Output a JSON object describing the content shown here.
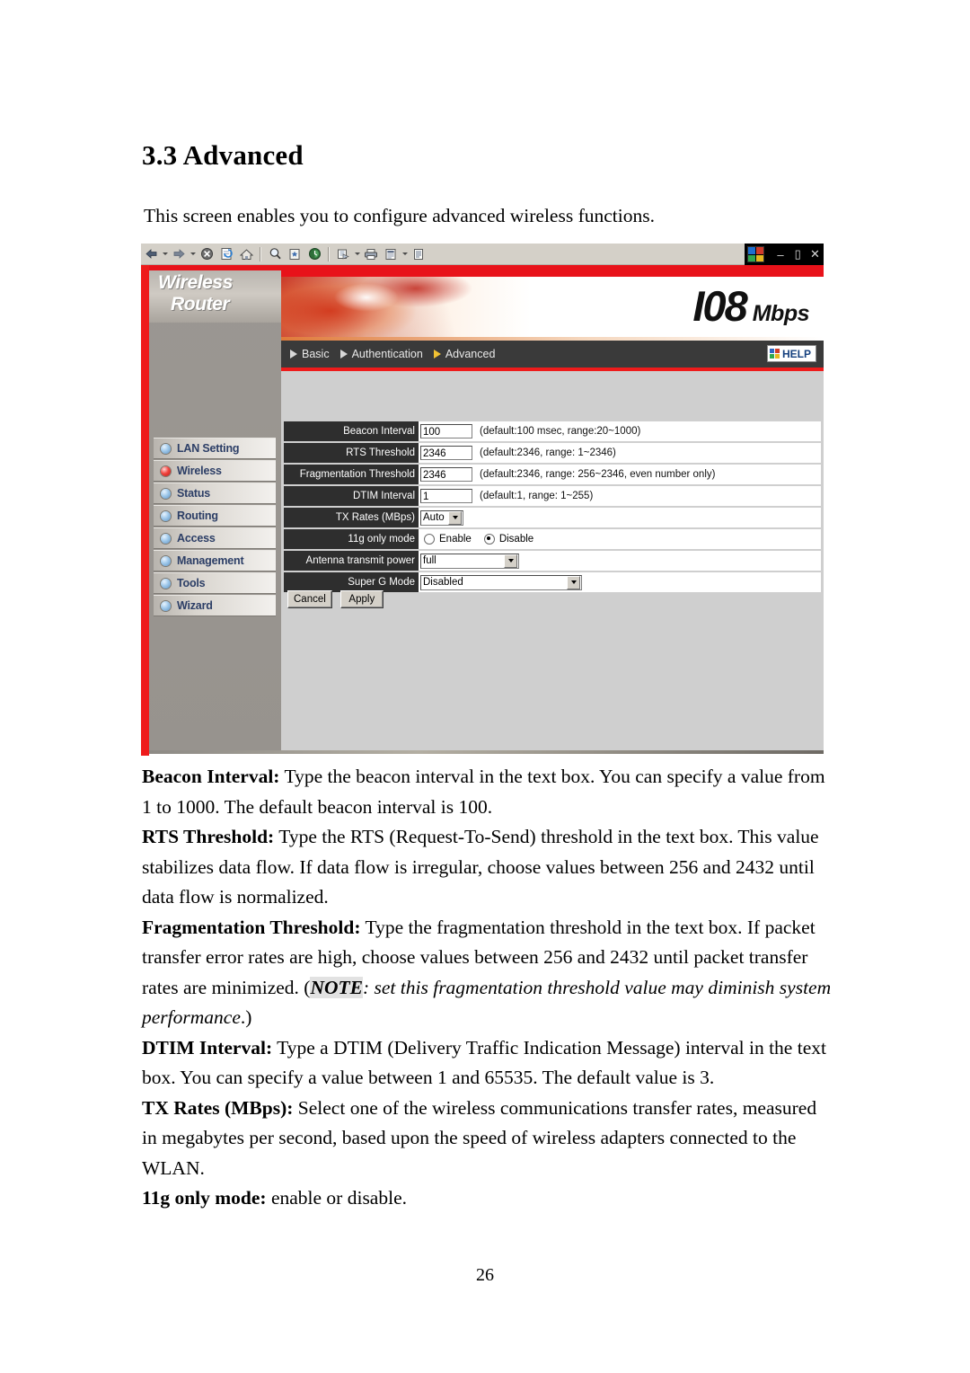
{
  "document": {
    "heading": "3.3 Advanced",
    "intro": "This screen enables you to configure advanced wireless functions.",
    "page_number": "26",
    "paragraphs": [
      {
        "term": "Beacon Interval:",
        "text": " Type the beacon interval in the text box. You can specify a value from 1 to 1000. The default beacon interval is 100."
      },
      {
        "term": "RTS Threshold:",
        "text": " Type the RTS (Request-To-Send) threshold in the text box. This value stabilizes data flow. If data flow is irregular, choose values between 256 and 2432 until data flow is normalized."
      },
      {
        "term": "Fragmentation Threshold:",
        "text": " Type the fragmentation threshold in the text box. If packet transfer error rates are high, choose values between 256 and 2432 until packet transfer rates are minimized. (",
        "note_tag": "NOTE",
        "note_text": ": set this fragmentation threshold value may diminish system performance",
        "note_tail": ".)"
      },
      {
        "term": "DTIM Interval:",
        "text": " Type a DTIM (Delivery Traffic Indication Message) interval in the text box. You can specify a value between 1 and 65535. The default value is 3."
      },
      {
        "term": "TX Rates (MBps):",
        "text": " Select one of the wireless communications transfer rates, measured in megabytes per second, based upon the speed of wireless adapters connected to the WLAN."
      },
      {
        "term": "11g only mode:",
        "text": " enable or disable."
      }
    ]
  },
  "browser": {
    "toolbar_icons": [
      "back-icon",
      "back-dropdown-icon",
      "forward-icon",
      "forward-dropdown-icon",
      "stop-icon",
      "refresh-icon",
      "home-icon",
      "search-icon",
      "favorites-icon",
      "history-icon",
      "mail-icon",
      "mail-dropdown-icon",
      "print-icon",
      "edit-icon",
      "edit-dropdown-icon",
      "discuss-icon"
    ],
    "window_controls": {
      "logo": "windows-logo-icon",
      "minimize": "–",
      "restore": "❐",
      "close": "✕"
    }
  },
  "router": {
    "brand_line1": "Wireless",
    "brand_line2": "Router",
    "banner": {
      "speed_number": "I08",
      "speed_unit": "Mbps"
    },
    "nav": {
      "items": [
        {
          "label": "Basic",
          "active": false
        },
        {
          "label": "Authentication",
          "active": false
        },
        {
          "label": "Advanced",
          "active": true
        }
      ],
      "help_label": "HELP"
    },
    "sidebar": {
      "items": [
        {
          "label": "LAN Setting",
          "active": false
        },
        {
          "label": "Wireless",
          "active": true
        },
        {
          "label": "Status",
          "active": false
        },
        {
          "label": "Routing",
          "active": false
        },
        {
          "label": "Access",
          "active": false
        },
        {
          "label": "Management",
          "active": false
        },
        {
          "label": "Tools",
          "active": false
        },
        {
          "label": "Wizard",
          "active": false
        }
      ]
    },
    "form": {
      "beacon_interval": {
        "label": "Beacon Interval",
        "value": "100",
        "hint": "(default:100 msec, range:20~1000)"
      },
      "rts_threshold": {
        "label": "RTS Threshold",
        "value": "2346",
        "hint": "(default:2346, range: 1~2346)"
      },
      "fragmentation_threshold": {
        "label": "Fragmentation Threshold",
        "value": "2346",
        "hint": "(default:2346, range: 256~2346, even number only)"
      },
      "dtim_interval": {
        "label": "DTIM Interval",
        "value": "1",
        "hint": "(default:1, range: 1~255)"
      },
      "tx_rates": {
        "label": "TX Rates (MBps)",
        "value": "Auto"
      },
      "g_only_mode": {
        "label": "11g only mode",
        "enable_label": "Enable",
        "disable_label": "Disable",
        "selected": "Disable"
      },
      "antenna_transmit_power": {
        "label": "Antenna transmit power",
        "value": "full"
      },
      "super_g_mode": {
        "label": "Super G Mode",
        "value": "Disabled"
      },
      "buttons": {
        "cancel": "Cancel",
        "apply": "Apply"
      }
    }
  }
}
